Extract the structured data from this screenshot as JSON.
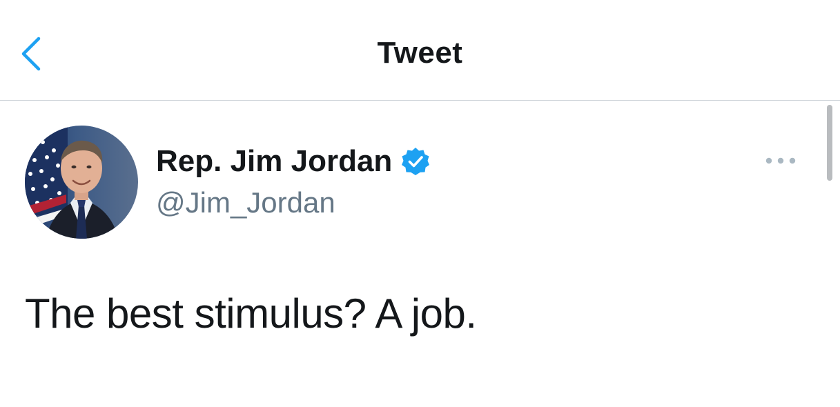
{
  "header": {
    "title": "Tweet",
    "back_icon": "chevron-left-icon"
  },
  "tweet": {
    "author": {
      "name": "Rep. Jim Jordan",
      "handle": "@Jim_Jordan",
      "verified": true,
      "verified_icon": "verified-badge-icon"
    },
    "more_icon": "more-horizontal-icon",
    "text": "The best stimulus? A job."
  },
  "colors": {
    "accent": "#1DA1F2",
    "text_primary": "#14171A",
    "text_secondary": "#657786",
    "divider": "#CFD5DA",
    "more_dots": "#AAB8C2"
  }
}
